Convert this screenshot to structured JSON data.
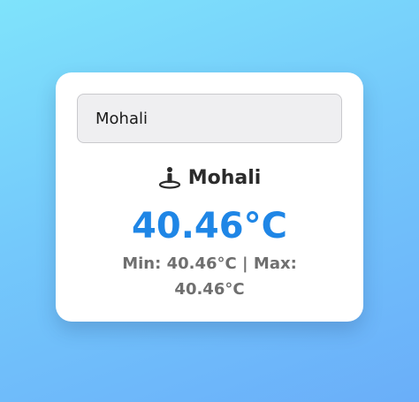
{
  "search": {
    "value": "Mohali"
  },
  "weather": {
    "city_icon": "person-location-icon",
    "city": "Mohali",
    "temperature": "40.46°C",
    "min_label": "Min:",
    "min_value": "40.46°C",
    "separator": "|",
    "max_label": "Max:",
    "max_value": "40.46°C"
  },
  "colors": {
    "temperature": "#1f86e6",
    "card_background": "#ffffff",
    "input_background": "#efeff1"
  }
}
